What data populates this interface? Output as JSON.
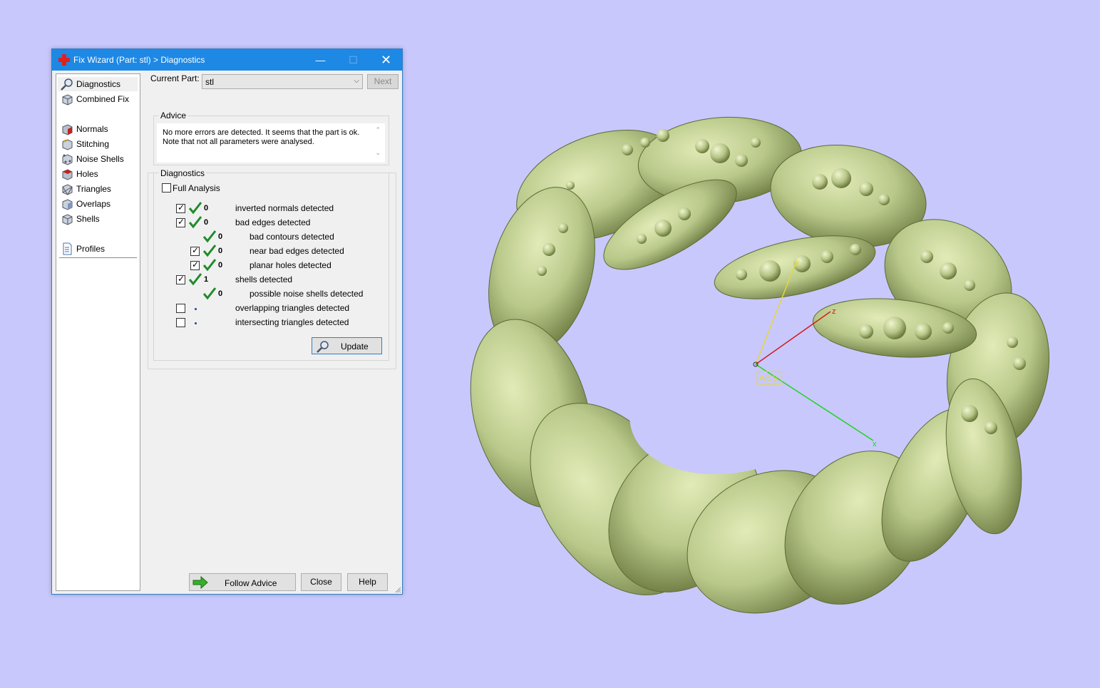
{
  "window": {
    "title": "Fix Wizard (Part: stl) > Diagnostics",
    "controls": {
      "minimize": "—",
      "maximize": "☐",
      "close": "✕"
    }
  },
  "nav": {
    "items": [
      {
        "label": "Diagnostics",
        "icon": "magnifier-icon"
      },
      {
        "label": "Combined Fix",
        "icon": "cube-icon"
      },
      {
        "label": "Normals",
        "icon": "normals-cube-icon"
      },
      {
        "label": "Stitching",
        "icon": "stitching-cube-icon"
      },
      {
        "label": "Noise Shells",
        "icon": "noise-shells-icon"
      },
      {
        "label": "Holes",
        "icon": "holes-cube-icon"
      },
      {
        "label": "Triangles",
        "icon": "triangles-cube-icon"
      },
      {
        "label": "Overlaps",
        "icon": "overlaps-cube-icon"
      },
      {
        "label": "Shells",
        "icon": "shells-cube-icon"
      },
      {
        "label": "Profiles",
        "icon": "document-icon"
      }
    ]
  },
  "current_part": {
    "label": "Current Part:",
    "value": "stl"
  },
  "next_button": "Next",
  "advice": {
    "title": "Advice",
    "line1": "No more errors are detected. It seems that the part is ok.",
    "line2": "Note that not all parameters were analysed."
  },
  "diagnostics": {
    "title": "Diagnostics",
    "full_analysis_label": "Full Analysis",
    "rows": [
      {
        "count": "0",
        "label": "inverted normals detected",
        "checked": true,
        "status": "ok"
      },
      {
        "count": "0",
        "label": "bad edges detected",
        "checked": true,
        "status": "ok"
      },
      {
        "count": "0",
        "label": "bad contours detected",
        "status": "ok"
      },
      {
        "count": "0",
        "label": "near bad edges detected",
        "checked": true,
        "status": "ok"
      },
      {
        "count": "0",
        "label": "planar holes detected",
        "checked": true,
        "status": "ok"
      },
      {
        "count": "1",
        "label": "shells detected",
        "checked": true,
        "status": "ok"
      },
      {
        "count": "0",
        "label": "possible noise shells detected",
        "status": "ok"
      },
      {
        "count": "",
        "label": "overlapping triangles detected",
        "checked": false,
        "status": "not-analysed"
      },
      {
        "count": "",
        "label": "intersecting triangles detected",
        "checked": false,
        "status": "not-analysed"
      }
    ],
    "update_button": "Update"
  },
  "footer": {
    "follow_advice": "Follow Advice",
    "close": "Close",
    "help": "Help"
  },
  "viewport": {
    "background_color": "#c8c8fc",
    "model_color": "#b9c98a",
    "axis_labels": {
      "x": "x",
      "y": "y",
      "z": "z"
    },
    "origin_label": "WCS"
  }
}
